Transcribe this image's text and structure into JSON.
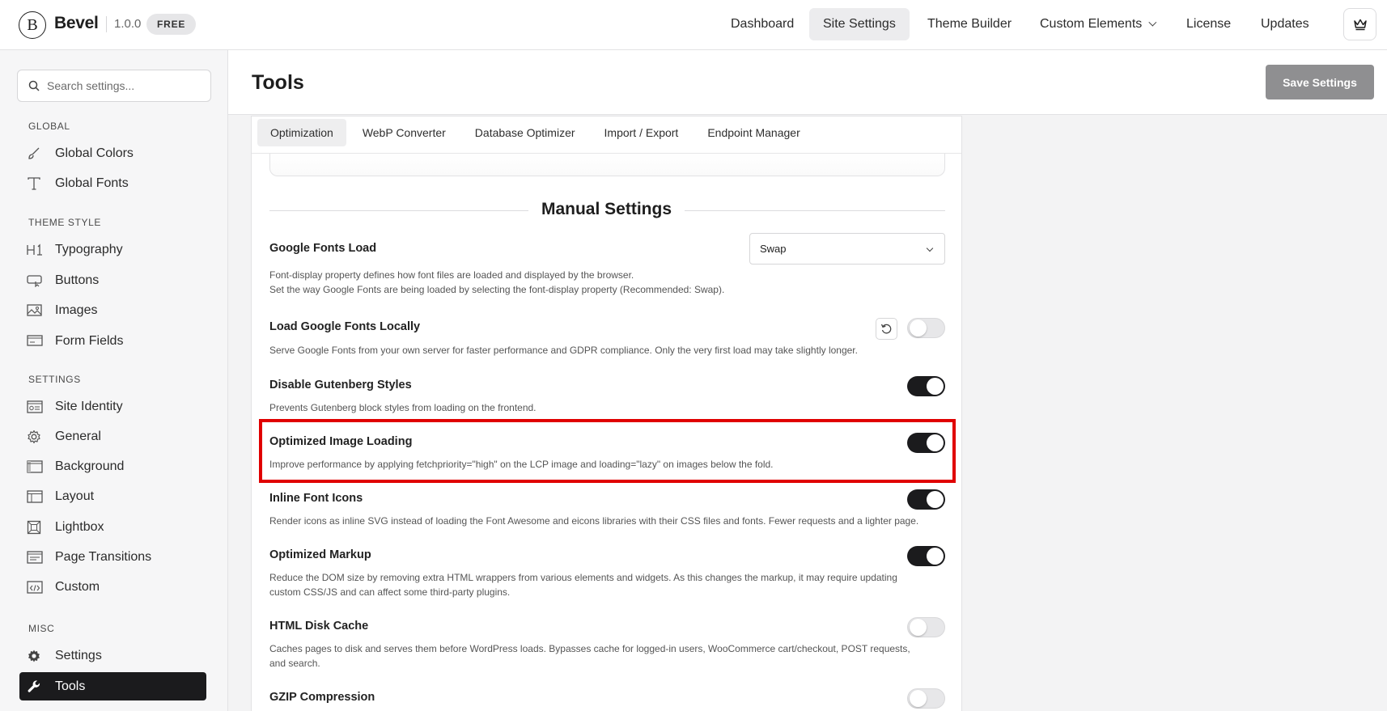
{
  "header": {
    "brand": "Bevel",
    "version": "1.0.0",
    "badge": "FREE",
    "nav": [
      {
        "label": "Dashboard"
      },
      {
        "label": "Site Settings"
      },
      {
        "label": "Theme Builder"
      },
      {
        "label": "Custom Elements"
      },
      {
        "label": "License"
      },
      {
        "label": "Updates"
      }
    ],
    "active_nav": "Site Settings"
  },
  "sidebar": {
    "search_placeholder": "Search settings...",
    "sections": [
      {
        "title": "GLOBAL",
        "items": [
          {
            "label": "Global Colors",
            "icon": "brush-icon"
          },
          {
            "label": "Global Fonts",
            "icon": "font-icon"
          }
        ]
      },
      {
        "title": "THEME STYLE",
        "items": [
          {
            "label": "Typography",
            "icon": "heading-icon"
          },
          {
            "label": "Buttons",
            "icon": "button-icon"
          },
          {
            "label": "Images",
            "icon": "image-icon"
          },
          {
            "label": "Form Fields",
            "icon": "form-icon"
          }
        ]
      },
      {
        "title": "SETTINGS",
        "items": [
          {
            "label": "Site Identity",
            "icon": "identity-icon"
          },
          {
            "label": "General",
            "icon": "gear-icon"
          },
          {
            "label": "Background",
            "icon": "background-icon"
          },
          {
            "label": "Layout",
            "icon": "layout-icon"
          },
          {
            "label": "Lightbox",
            "icon": "lightbox-icon"
          },
          {
            "label": "Page Transitions",
            "icon": "transitions-icon"
          },
          {
            "label": "Custom",
            "icon": "code-icon"
          }
        ]
      },
      {
        "title": "MISC",
        "items": [
          {
            "label": "Settings",
            "icon": "settings-gear-icon"
          },
          {
            "label": "Tools",
            "icon": "wrench-icon"
          }
        ]
      }
    ],
    "active_item": "Tools"
  },
  "main": {
    "title": "Tools",
    "save_label": "Save Settings",
    "tabs": [
      {
        "label": "Optimization"
      },
      {
        "label": "WebP Converter"
      },
      {
        "label": "Database Optimizer"
      },
      {
        "label": "Import / Export"
      },
      {
        "label": "Endpoint Manager"
      }
    ],
    "active_tab": "Optimization",
    "section_title": "Manual Settings",
    "settings": [
      {
        "title": "Google Fonts Load",
        "desc": [
          "Font-display property defines how font files are loaded and displayed by the browser.",
          "Set the way Google Fonts are being loaded by selecting the font-display property (Recommended: Swap)."
        ],
        "control": "select",
        "value": "Swap"
      },
      {
        "title": "Load Google Fonts Locally",
        "desc": [
          "Serve Google Fonts from your own server for faster performance and GDPR compliance. Only the very first load may take slightly longer."
        ],
        "control": "toggle",
        "enabled": false
      },
      {
        "title": "Disable Gutenberg Styles",
        "desc": [
          "Prevents Gutenberg block styles from loading on the frontend."
        ],
        "control": "toggle",
        "enabled": true
      },
      {
        "title": "Optimized Image Loading",
        "desc": [
          "Improve performance by applying fetchpriority=\"high\" on the LCP image and loading=\"lazy\" on images below the fold."
        ],
        "control": "toggle",
        "enabled": true,
        "highlighted": true
      },
      {
        "title": "Inline Font Icons",
        "desc": [
          "Render icons as inline SVG instead of loading the Font Awesome and eicons libraries with their CSS files and fonts. Fewer requests and a lighter page."
        ],
        "control": "toggle",
        "enabled": true
      },
      {
        "title": "Optimized Markup",
        "desc": [
          "Reduce the DOM size by removing extra HTML wrappers from various elements and widgets. As this changes the markup, it may require updating",
          "custom CSS/JS and can affect some third-party plugins."
        ],
        "control": "toggle",
        "enabled": true
      },
      {
        "title": "HTML Disk Cache",
        "desc": [
          "Caches pages to disk and serves them before WordPress loads. Bypasses cache for logged-in users, WooCommerce cart/checkout, POST requests,",
          "and search."
        ],
        "control": "toggle",
        "enabled": false
      },
      {
        "title": "GZIP Compression",
        "desc": [],
        "control": "toggle",
        "enabled": false
      }
    ]
  },
  "colors": {
    "highlight": "#e00000",
    "toggle_on": "#1b1b1d",
    "save_button": "#8f8f91"
  }
}
